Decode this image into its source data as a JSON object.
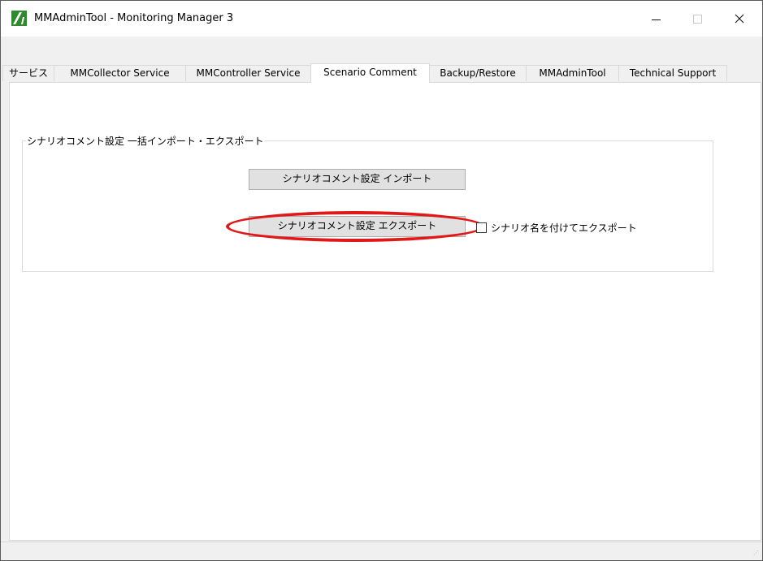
{
  "window": {
    "title": "MMAdminTool - Monitoring Manager 3",
    "controls": {
      "minimize": "—",
      "maximize": "☐",
      "close": "✕"
    }
  },
  "tabs": [
    {
      "label": "サービス",
      "active": false
    },
    {
      "label": "MMCollector Service",
      "active": false
    },
    {
      "label": "MMController Service",
      "active": false
    },
    {
      "label": "Scenario Comment",
      "active": true
    },
    {
      "label": "Backup/Restore",
      "active": false
    },
    {
      "label": "MMAdminTool",
      "active": false
    },
    {
      "label": "Technical Support",
      "active": false
    }
  ],
  "group": {
    "legend": "シナリオコメント設定 一括インポート・エクスポート",
    "import_button": "シナリオコメント設定 インポート",
    "export_button": "シナリオコメント設定 エクスポート",
    "checkbox_label": "シナリオ名を付けてエクスポート",
    "checkbox_checked": false
  },
  "annotation": {
    "highlight_color": "#e01818"
  },
  "colors": {
    "app_icon": "#2f8a2f"
  }
}
